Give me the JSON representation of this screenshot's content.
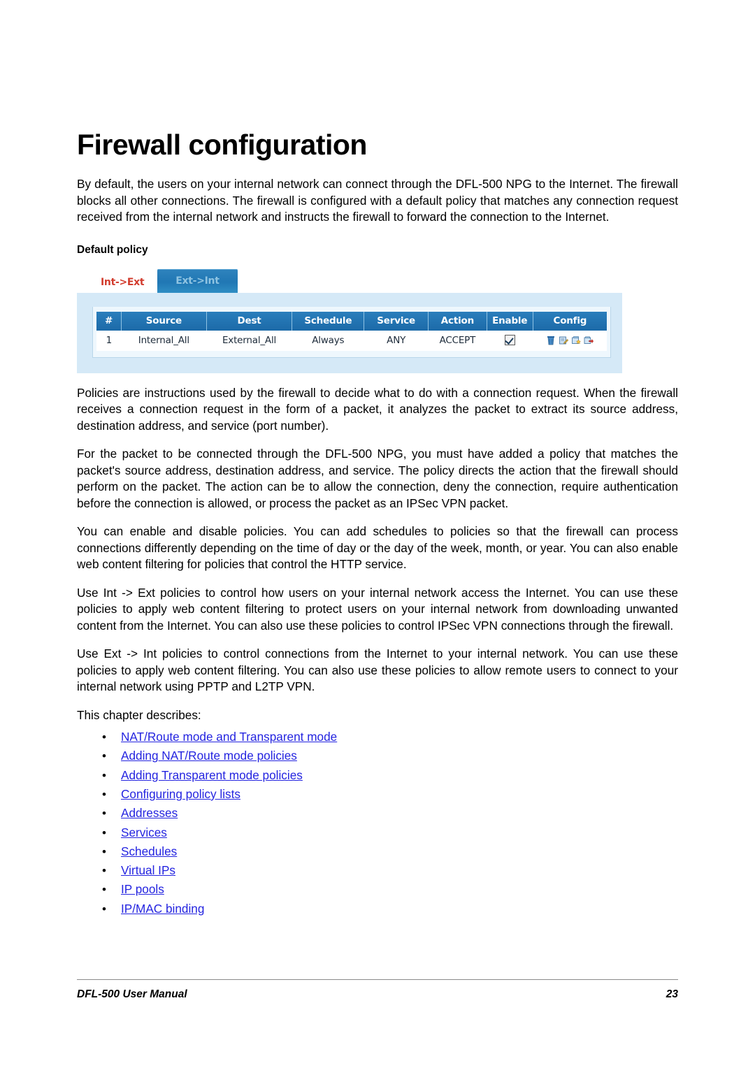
{
  "document": {
    "title": "Firewall configuration"
  },
  "paragraphs": [
    "By default, the users on your internal network can connect through the DFL-500 NPG to the Internet. The firewall blocks all other connections. The firewall is configured with a default policy that matches any connection request received from the internal network and instructs the firewall to forward the connection to the Internet.",
    "Policies are instructions used by the firewall to decide what to do with a connection request. When the firewall receives a connection request in the form of a packet, it analyzes the packet to extract its source address, destination address, and service (port number).",
    "For the packet to be connected through the DFL-500 NPG, you must have added a policy that matches the packet's source address, destination address, and service. The policy directs the action that the firewall should perform on the packet. The action can be to allow the connection, deny the connection, require authentication before the connection is allowed, or process the packet as an IPSec VPN packet.",
    "You can enable and disable policies. You can add schedules to policies so that the firewall can process connections differently depending on the time of day or the day of the week, month, or year. You can also enable web content filtering for policies that control the HTTP service.",
    "Use Int -> Ext policies to control how users on your internal network access the Internet. You can use these policies to apply web content filtering to protect users on your internal network from downloading unwanted content from the Internet. You can also use these policies to control IPSec VPN connections through the firewall.",
    "Use Ext -> Int policies to control connections from the Internet to your internal network. You can use these policies to apply web content filtering. You can also use these policies to allow remote users to connect to your internal network using PPTP and L2TP VPN.",
    "This chapter describes:"
  ],
  "figure": {
    "caption": "Default policy",
    "tabs": [
      {
        "label": "Int->Ext",
        "active": true
      },
      {
        "label": "Ext->Int",
        "active": false
      }
    ],
    "table": {
      "columns": [
        "#",
        "Source",
        "Dest",
        "Schedule",
        "Service",
        "Action",
        "Enable",
        "Config"
      ],
      "rows": [
        {
          "num": "1",
          "source": "Internal_All",
          "dest": "External_All",
          "schedule": "Always",
          "service": "ANY",
          "action": "ACCEPT",
          "enable_checked": true,
          "config_icons": [
            "delete-icon",
            "edit-icon",
            "clone-icon",
            "insert-icon"
          ]
        }
      ]
    },
    "colors": {
      "panel_background": "#d5e9f7",
      "header_bar": "#1c6aa8",
      "active_tab_text": "#d23c2e",
      "inactive_tab_background": "#2077b4",
      "inactive_tab_text": "#8fc4e2"
    }
  },
  "chapter_list": [
    "NAT/Route mode and Transparent mode",
    "Adding NAT/Route mode policies",
    "Adding Transparent mode policies",
    "Configuring policy lists",
    "Addresses",
    "Services",
    "Schedules",
    "Virtual IPs",
    "IP pools",
    "IP/MAC binding"
  ],
  "bullet_glyph": "•",
  "footer": {
    "left": "DFL-500 User Manual",
    "page_number": "23"
  }
}
